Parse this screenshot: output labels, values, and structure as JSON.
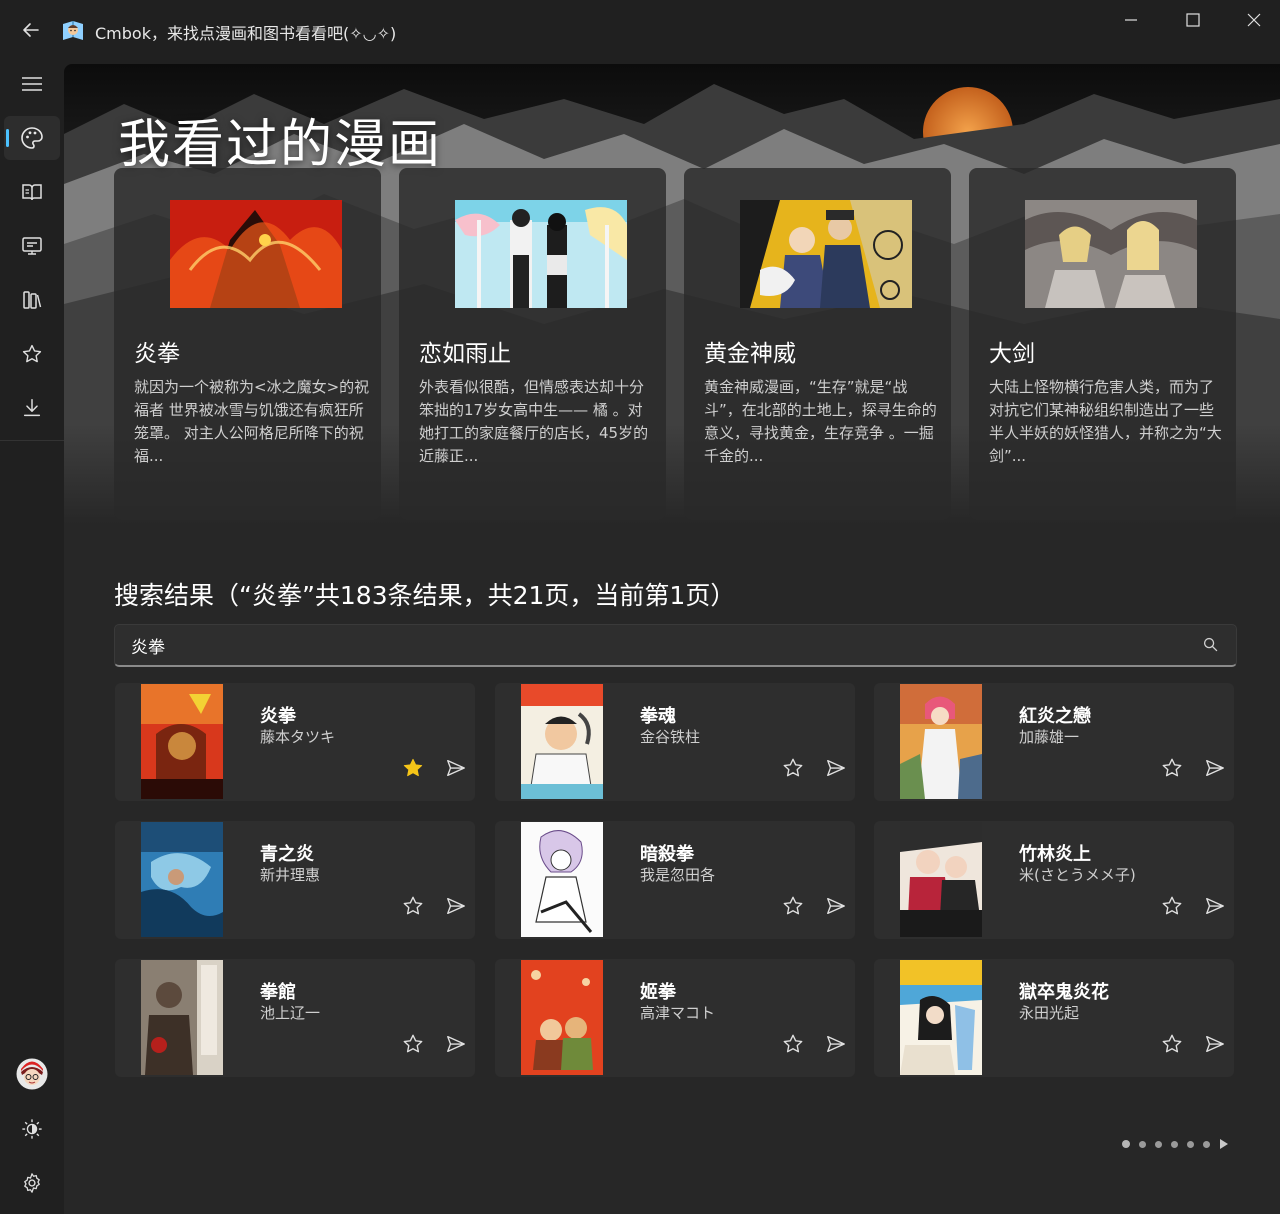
{
  "titlebar": {
    "title": "Cmbok，来找点漫画和图书看看吧(✧◡✧)",
    "back_icon": "arrow-left-icon",
    "minimize_icon": "minimize-icon",
    "maximize_icon": "maximize-icon",
    "close_icon": "close-icon"
  },
  "sidebar": {
    "items": [
      {
        "icon": "hamburger-icon",
        "active": false
      },
      {
        "icon": "palette-icon",
        "active": true
      },
      {
        "icon": "book-open-icon",
        "active": false
      },
      {
        "icon": "monitor-icon",
        "active": false
      },
      {
        "icon": "library-icon",
        "active": false
      },
      {
        "icon": "star-icon",
        "active": false
      },
      {
        "icon": "download-icon",
        "active": false
      }
    ],
    "bottom": [
      {
        "icon": "avatar"
      },
      {
        "icon": "brightness-icon"
      },
      {
        "icon": "gear-icon"
      }
    ]
  },
  "hero": {
    "title": "我看过的漫画",
    "cards": [
      {
        "title": "炎拳",
        "desc": "就因为一个被称为<冰之魔女>的祝福者 世界被冰雪与饥饿还有疯狂所笼罩。 对主人公阿格尼所降下的祝福..."
      },
      {
        "title": "恋如雨止",
        "desc": "外表看似很酷，但情感表达却十分笨拙的17岁女高中生—— 橘 。对她打工的家庭餐厅的店长，45岁的近藤正..."
      },
      {
        "title": "黄金神威",
        "desc": "黄金神威漫画，“生存”就是“战斗”，在北部的土地上，探寻生命的意义，寻找黄金，生存竞争 。一掘千金的..."
      },
      {
        "title": "大剑",
        "desc": "大陆上怪物横行危害人类，而为了对抗它们某神秘组织制造出了一些半人半妖的妖怪猎人，并称之为“大剑”..."
      }
    ]
  },
  "results": {
    "heading": "搜索结果（“炎拳”共183条结果，共21页，当前第1页）",
    "search_value": "炎拳",
    "items": [
      {
        "title": "炎拳",
        "author": "藤本タツキ",
        "favorited": true
      },
      {
        "title": "拳魂",
        "author": "金谷铁柱",
        "favorited": false
      },
      {
        "title": "紅炎之戀",
        "author": "加藤雄一",
        "favorited": false
      },
      {
        "title": "青之炎",
        "author": "新井理惠",
        "favorited": false
      },
      {
        "title": "暗殺拳",
        "author": "我是忽田各",
        "favorited": false
      },
      {
        "title": "竹林炎上",
        "author": "米(さとうメメ子)",
        "favorited": false
      },
      {
        "title": "拳館",
        "author": "池上辽一",
        "favorited": false
      },
      {
        "title": "姬拳",
        "author": "高津マコト",
        "favorited": false
      },
      {
        "title": "獄卒鬼炎花",
        "author": "永田光起",
        "favorited": false
      }
    ]
  },
  "colors": {
    "accent": "#4cc2ff",
    "favorite": "#f5c518",
    "background": "#202020",
    "content": "#272727",
    "card": "#2e2e2e"
  }
}
